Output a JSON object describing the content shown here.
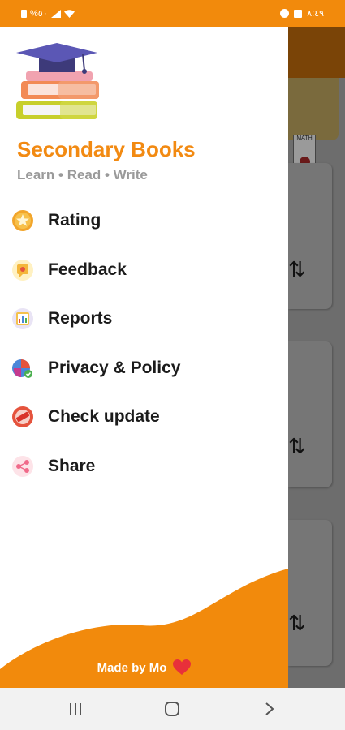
{
  "status_bar": {
    "left_text": "%٥٠",
    "right_text": "٨:٤٩"
  },
  "drawer": {
    "app_name": "Secondary Books",
    "tagline": "Learn • Read • Write",
    "menu": [
      {
        "label": "Rating",
        "icon": "star-icon"
      },
      {
        "label": "Feedback",
        "icon": "feedback-icon"
      },
      {
        "label": "Reports",
        "icon": "reports-icon"
      },
      {
        "label": "Privacy & Policy",
        "icon": "privacy-shield-icon"
      },
      {
        "label": "Check update",
        "icon": "update-icon"
      },
      {
        "label": "Share",
        "icon": "share-icon"
      }
    ],
    "footer": {
      "text": "Made by Mo"
    }
  },
  "background": {
    "book_label": "MATH"
  },
  "colors": {
    "accent": "#f28a0c",
    "title": "#f28a12",
    "tagline": "#9a9a9a"
  }
}
